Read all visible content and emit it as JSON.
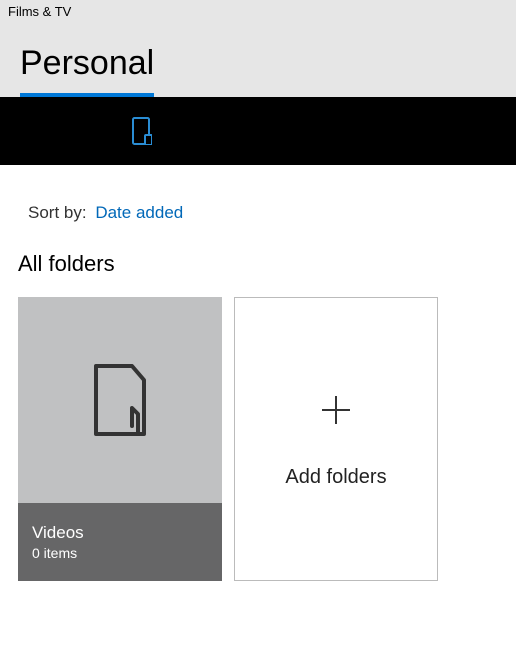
{
  "window": {
    "title": "Films & TV"
  },
  "page": {
    "title": "Personal"
  },
  "sort": {
    "label": "Sort by:",
    "value": "Date added"
  },
  "section": {
    "title": "All folders"
  },
  "folders": [
    {
      "name": "Videos",
      "count": "0 items"
    }
  ],
  "add": {
    "label": "Add folders"
  }
}
